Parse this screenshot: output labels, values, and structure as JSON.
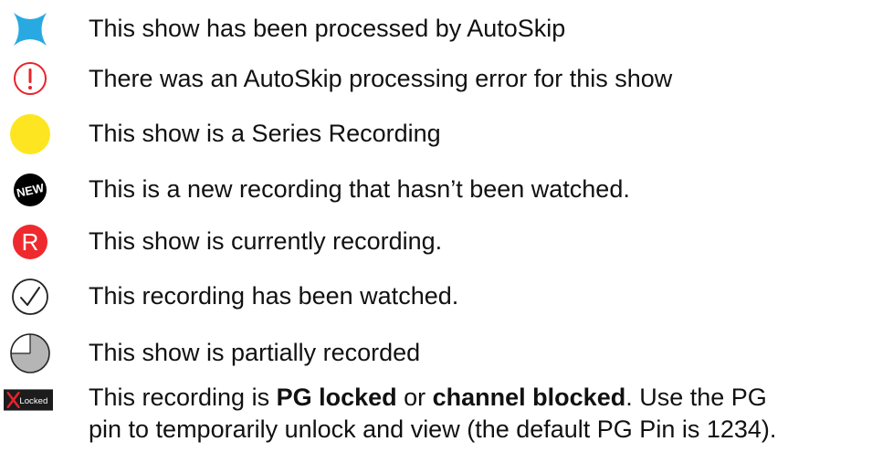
{
  "legend": {
    "items": [
      {
        "icon": "autoskip-bowtie-icon",
        "text": "This show has been processed by AutoSkip"
      },
      {
        "icon": "error-exclamation-icon",
        "text": "There was an AutoSkip processing error for this show"
      },
      {
        "icon": "series-recording-dot-icon",
        "text": "This show is a Series Recording"
      },
      {
        "icon": "new-badge-icon",
        "badge": "NEW",
        "text": "This is a new recording that hasn’t been watched."
      },
      {
        "icon": "recording-r-icon",
        "badge": "R",
        "text": "This show is currently recording."
      },
      {
        "icon": "watched-check-icon",
        "text": "This recording has been watched."
      },
      {
        "icon": "partial-recording-pie-icon",
        "text": "This show is partially recorded"
      },
      {
        "icon": "locked-icon",
        "badge": "Locked",
        "text_parts": {
          "a": "This recording is ",
          "b": "PG locked",
          "c": " or ",
          "d": "channel blocked",
          "e": ". Use the PG",
          "line2": "pin to temporarily unlock and view (the default PG Pin is 1234)."
        }
      }
    ]
  },
  "colors": {
    "autoskip": "#29a9e1",
    "error": "#e8232b",
    "series": "#fde621",
    "new_bg": "#000000",
    "recording": "#ee2a2e",
    "pie_fill": "#b5b5b5",
    "locked_bg": "#1c1c1c",
    "locked_x": "#e8232b"
  }
}
